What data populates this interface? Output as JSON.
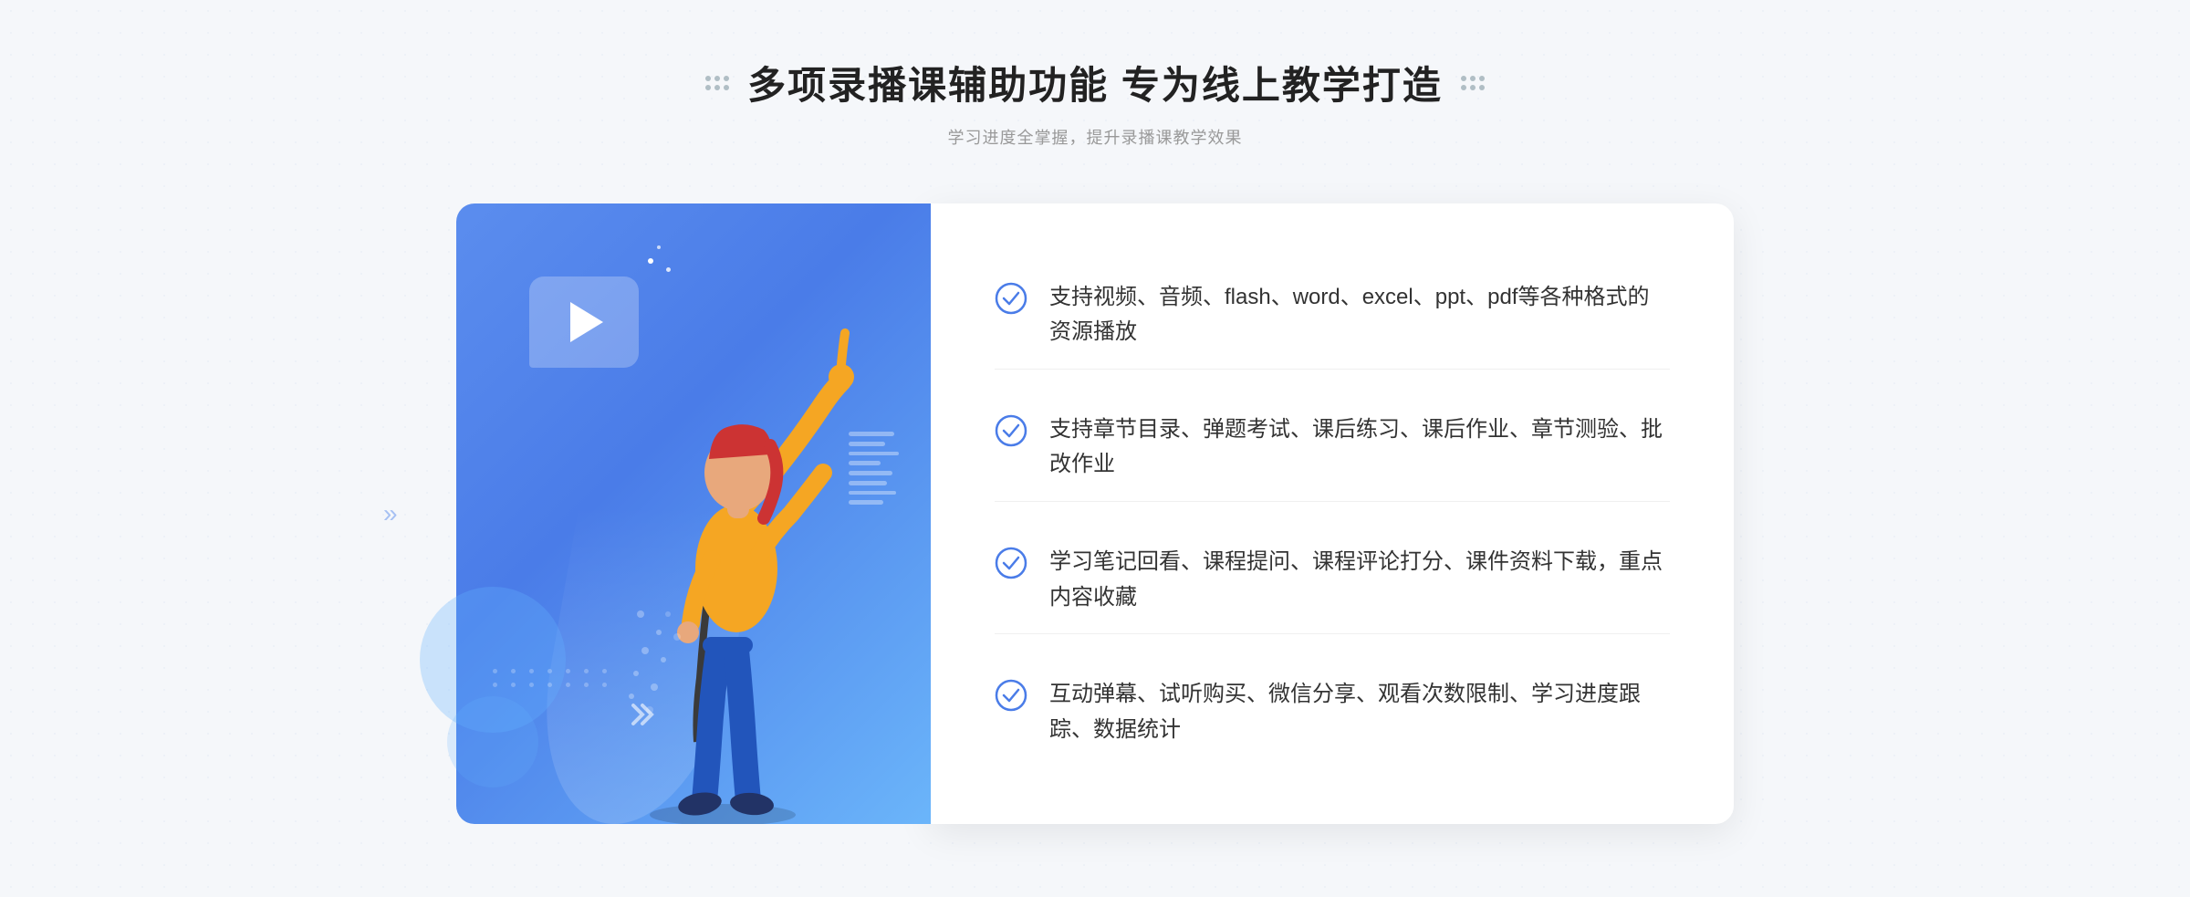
{
  "header": {
    "title": "多项录播课辅助功能 专为线上教学打造",
    "subtitle": "学习进度全掌握，提升录播课教学效果"
  },
  "features": [
    {
      "id": "feature-1",
      "text": "支持视频、音频、flash、word、excel、ppt、pdf等各种格式的资源播放"
    },
    {
      "id": "feature-2",
      "text": "支持章节目录、弹题考试、课后练习、课后作业、章节测验、批改作业"
    },
    {
      "id": "feature-3",
      "text": "学习笔记回看、课程提问、课程评论打分、课件资料下载，重点内容收藏"
    },
    {
      "id": "feature-4",
      "text": "互动弹幕、试听购买、微信分享、观看次数限制、学习进度跟踪、数据统计"
    }
  ],
  "icons": {
    "check": "check-circle-icon",
    "play": "play-icon",
    "chevron_left": "«"
  },
  "colors": {
    "primary": "#4a7ce8",
    "primary_light": "#6bb5fa",
    "accent": "#5b8dee",
    "text_dark": "#222222",
    "text_medium": "#333333",
    "text_light": "#999999",
    "white": "#ffffff"
  }
}
